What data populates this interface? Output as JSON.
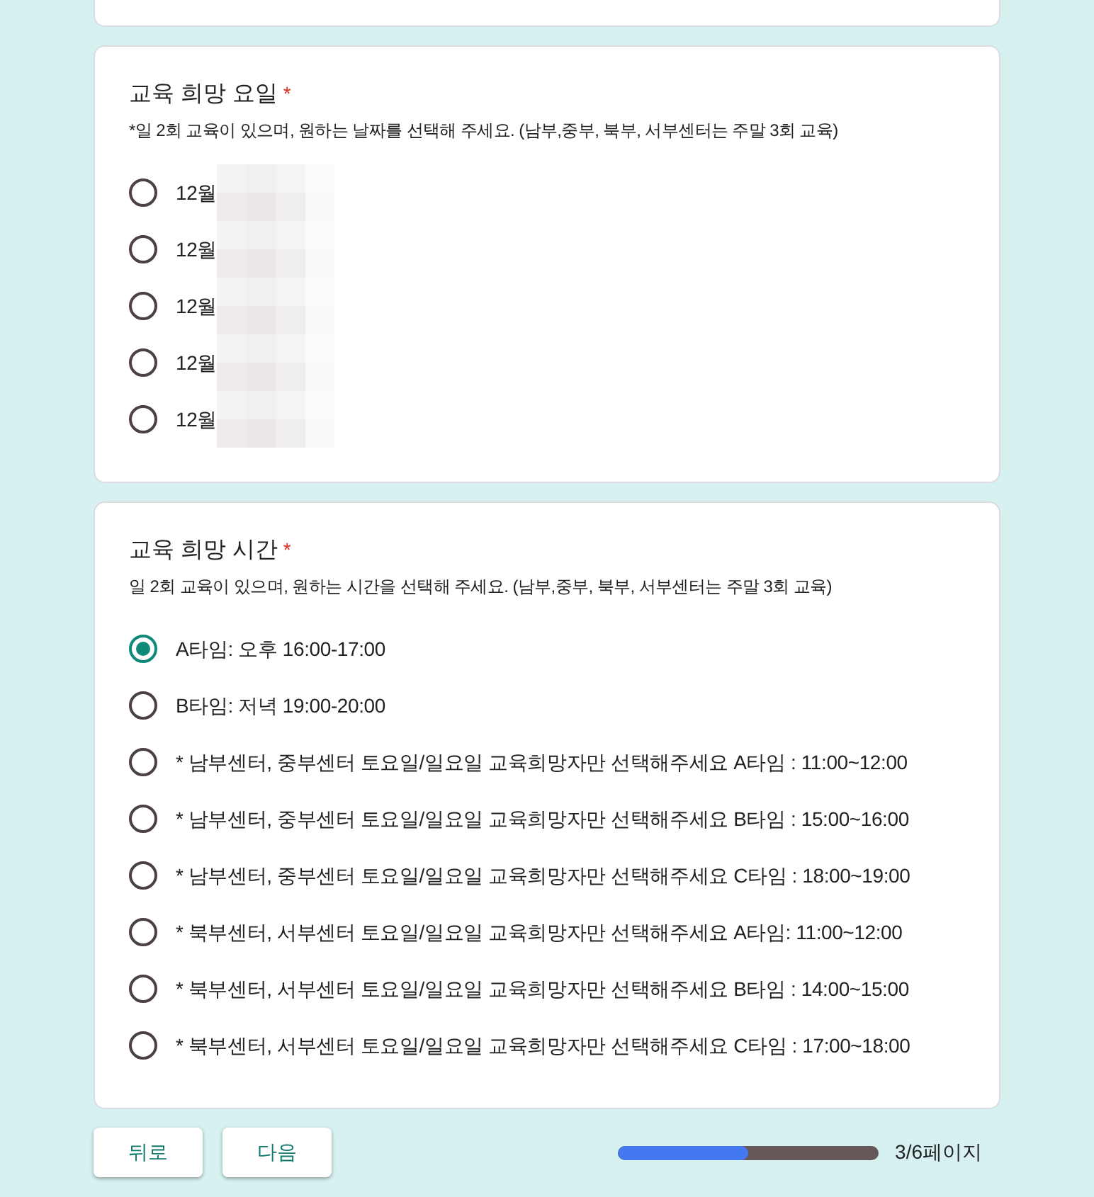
{
  "questions": [
    {
      "title": "교육 희망 요일",
      "required_mark": "*",
      "description": "*일 2회 교육이 있으며, 원하는 날짜를 선택해 주세요. (남부,중부, 북부, 서부센터는 주말 3회 교육)",
      "options": [
        {
          "label": "12월",
          "redacted": true,
          "selected": false
        },
        {
          "label": "12월",
          "redacted": true,
          "selected": false
        },
        {
          "label": "12월",
          "redacted": true,
          "selected": false
        },
        {
          "label": "12월",
          "redacted": true,
          "selected": false
        },
        {
          "label": "12월",
          "redacted": true,
          "selected": false
        }
      ]
    },
    {
      "title": "교육 희망 시간",
      "required_mark": "*",
      "description": "일 2회 교육이 있으며, 원하는 시간을 선택해 주세요. (남부,중부, 북부, 서부센터는 주말 3회 교육)",
      "options": [
        {
          "label": "A타임: 오후 16:00-17:00",
          "selected": true
        },
        {
          "label": "B타임: 저녁 19:00-20:00",
          "selected": false
        },
        {
          "label": "* 남부센터, 중부센터 토요일/일요일 교육희망자만 선택해주세요 A타임 : 11:00~12:00",
          "selected": false
        },
        {
          "label": "* 남부센터, 중부센터 토요일/일요일 교육희망자만 선택해주세요 B타임 : 15:00~16:00",
          "selected": false
        },
        {
          "label": "* 남부센터, 중부센터 토요일/일요일 교육희망자만 선택해주세요 C타임 : 18:00~19:00",
          "selected": false
        },
        {
          "label": "* 북부센터, 서부센터 토요일/일요일 교육희망자만 선택해주세요 A타임: 11:00~12:00",
          "selected": false
        },
        {
          "label": "* 북부센터, 서부센터 토요일/일요일 교육희망자만 선택해주세요 B타임 : 14:00~15:00",
          "selected": false
        },
        {
          "label": "* 북부센터, 서부센터 토요일/일요일 교육희망자만 선택해주세요 C타임 : 17:00~18:00",
          "selected": false
        }
      ]
    }
  ],
  "footer": {
    "buttons": [
      "뒤로",
      "다음"
    ],
    "progress": {
      "level": 0.5,
      "text": "3/6페이지"
    }
  }
}
